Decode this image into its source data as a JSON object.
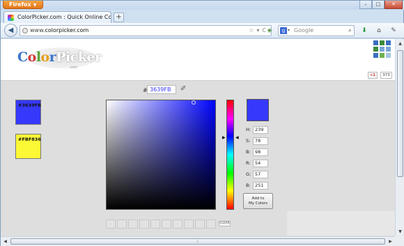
{
  "browser": {
    "app_button": "Firefox",
    "window_controls": {
      "minimize": "–",
      "maximize": "□",
      "close": "✕"
    },
    "tab_title": "ColorPicker.com : Quick Online Color Pi...",
    "new_tab": "+",
    "back_glyph": "◀",
    "url_prefix": "www.",
    "url_domain": "colorpicker.com",
    "url_icons": "☆▾C",
    "search_engine_letter": "g",
    "search_placeholder": "Google",
    "search_glyph": "⌕"
  },
  "site": {
    "logo_word1": [
      "C",
      "o",
      "l",
      "o",
      "r"
    ],
    "logo_word2": "Picker",
    "logo_sub": ".com",
    "header_swatches": [
      "#3a6fbf",
      "#3d8a3a",
      "#3a6fbf",
      "#3d8a3a",
      "#7aa6d8",
      "#7aa6d8",
      "#3a6fbf",
      "#6fb14f",
      "#a8c4e4"
    ],
    "gplus_label": "+1",
    "gplus_count": "373"
  },
  "picker": {
    "primary_color_label": "#3639FB",
    "primary_color": "#3639fb",
    "secondary_color_label": "#FBF836",
    "secondary_color": "#fbf836",
    "hex_prefix": "#",
    "hex_value": "3639FB",
    "fields": [
      {
        "label": "H:",
        "value": "239"
      },
      {
        "label": "S:",
        "value": "78"
      },
      {
        "label": "B:",
        "value": "98"
      },
      {
        "label": "R:",
        "value": "54"
      },
      {
        "label": "G:",
        "value": "57"
      },
      {
        "label": "B:",
        "value": "251"
      }
    ],
    "add_button_line1": "Add to",
    "add_button_line2": "My Colors",
    "clear_label": "CLEAR",
    "saved_slots": 10
  }
}
